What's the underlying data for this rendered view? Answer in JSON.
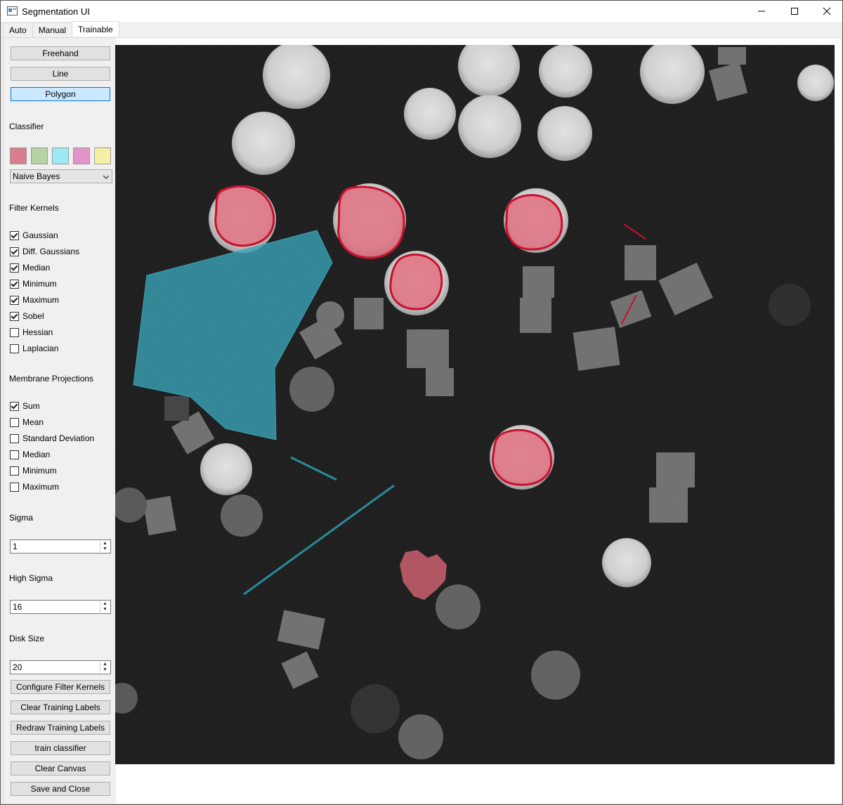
{
  "window": {
    "title": "Segmentation UI"
  },
  "tabs": [
    {
      "label": "Auto"
    },
    {
      "label": "Manual"
    },
    {
      "label": "Trainable"
    }
  ],
  "tools": {
    "freehand": "Freehand",
    "line": "Line",
    "polygon": "Polygon",
    "selected": "Polygon"
  },
  "classifier": {
    "label": "Classifier",
    "colors": [
      "#d87d8c",
      "#b5d3a3",
      "#9ae9f5",
      "#e294c8",
      "#f6f0a4"
    ],
    "selected": "Naive Bayes"
  },
  "filter_kernels": {
    "label": "Filter Kernels",
    "items": [
      {
        "label": "Gaussian",
        "checked": true
      },
      {
        "label": "Diff. Gaussians",
        "checked": true
      },
      {
        "label": "Median",
        "checked": true
      },
      {
        "label": "Minimum",
        "checked": true
      },
      {
        "label": "Maximum",
        "checked": true
      },
      {
        "label": "Sobel",
        "checked": true
      },
      {
        "label": "Hessian",
        "checked": false
      },
      {
        "label": "Laplacian",
        "checked": false
      }
    ]
  },
  "membrane_projections": {
    "label": "Membrane Projections",
    "items": [
      {
        "label": "Sum",
        "checked": true
      },
      {
        "label": "Mean",
        "checked": false
      },
      {
        "label": "Standard Deviation",
        "checked": false
      },
      {
        "label": "Median",
        "checked": false
      },
      {
        "label": "Minimum",
        "checked": false
      },
      {
        "label": "Maximum",
        "checked": false
      }
    ]
  },
  "sigma": {
    "label": "Sigma",
    "value": "1"
  },
  "high_sigma": {
    "label": "High Sigma",
    "value": "16"
  },
  "disk_size": {
    "label": "Disk Size",
    "value": "20"
  },
  "actions": {
    "configure": "Configure Filter Kernels",
    "clear_labels": "Clear Training Labels",
    "redraw_labels": "Redraw Training Labels",
    "train": "train classifier",
    "clear_canvas": "Clear Canvas",
    "save_close": "Save and Close"
  },
  "colors": {
    "label_red": "#c8102e",
    "label_cyan": "#2a8a9a",
    "button_selected": "#cce8ff",
    "button_selected_border": "#0078d7"
  }
}
